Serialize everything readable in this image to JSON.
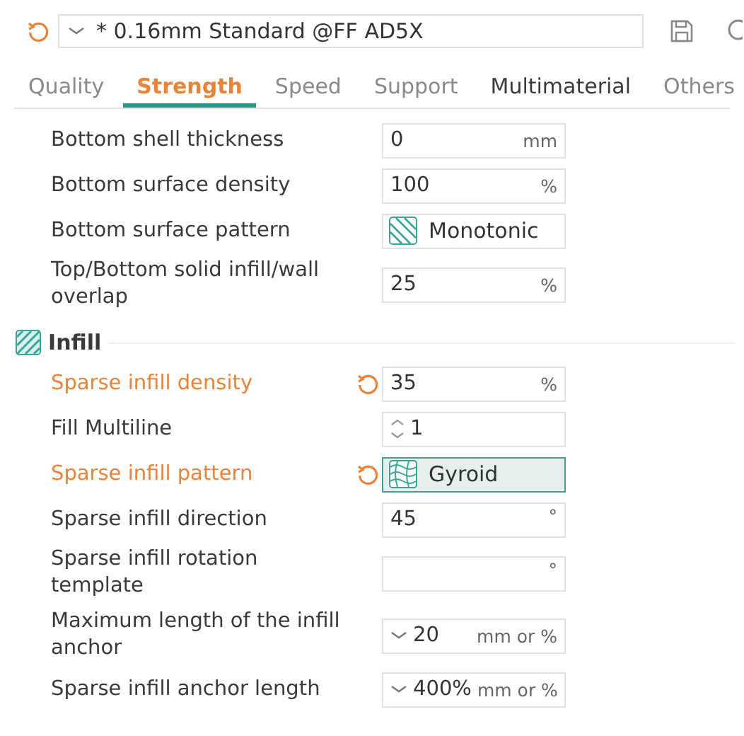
{
  "preset": {
    "value": "* 0.16mm Standard @FF AD5X"
  },
  "tabs": [
    {
      "label": "Quality",
      "selected": false,
      "highlighted": false
    },
    {
      "label": "Strength",
      "selected": true,
      "highlighted": false
    },
    {
      "label": "Speed",
      "selected": false,
      "highlighted": false
    },
    {
      "label": "Support",
      "selected": false,
      "highlighted": false
    },
    {
      "label": "Multimaterial",
      "selected": false,
      "highlighted": true
    },
    {
      "label": "Others",
      "selected": false,
      "highlighted": false
    }
  ],
  "sections": [
    {
      "rows": [
        {
          "kind": "number",
          "label": "Bottom shell thickness",
          "value": "0",
          "unit": "mm",
          "modified": false,
          "focused": false
        },
        {
          "kind": "number",
          "label": "Bottom surface density",
          "value": "100",
          "unit": "%",
          "modified": false,
          "focused": false
        },
        {
          "kind": "pattern",
          "label": "Bottom surface pattern",
          "value": "Monotonic",
          "modified": false,
          "focused": false
        },
        {
          "kind": "number",
          "label": "Top/Bottom solid infill/wall overlap",
          "value": "25",
          "unit": "%",
          "modified": false,
          "focused": false
        }
      ]
    },
    {
      "title": "Infill",
      "rows": [
        {
          "kind": "number",
          "label": "Sparse infill density",
          "value": "35",
          "unit": "%",
          "modified": true,
          "focused": false
        },
        {
          "kind": "spin",
          "label": "Fill Multiline",
          "value": "1",
          "modified": false,
          "focused": false
        },
        {
          "kind": "pattern",
          "label": "Sparse infill pattern",
          "value": "Gyroid",
          "modified": true,
          "focused": true
        },
        {
          "kind": "number",
          "label": "Sparse infill direction",
          "value": "45",
          "unit": "°",
          "modified": false,
          "focused": false
        },
        {
          "kind": "number",
          "label": "Sparse infill rotation template",
          "unit": "°",
          "modified": false,
          "focused": false
        },
        {
          "kind": "combo",
          "label": "Maximum length of the infill anchor",
          "value": "20",
          "unit": "mm or %",
          "modified": false,
          "focused": false
        },
        {
          "kind": "combo",
          "label": "Sparse infill anchor length",
          "value": "400%",
          "unit": "mm or %",
          "modified": false,
          "focused": false
        }
      ]
    }
  ]
}
